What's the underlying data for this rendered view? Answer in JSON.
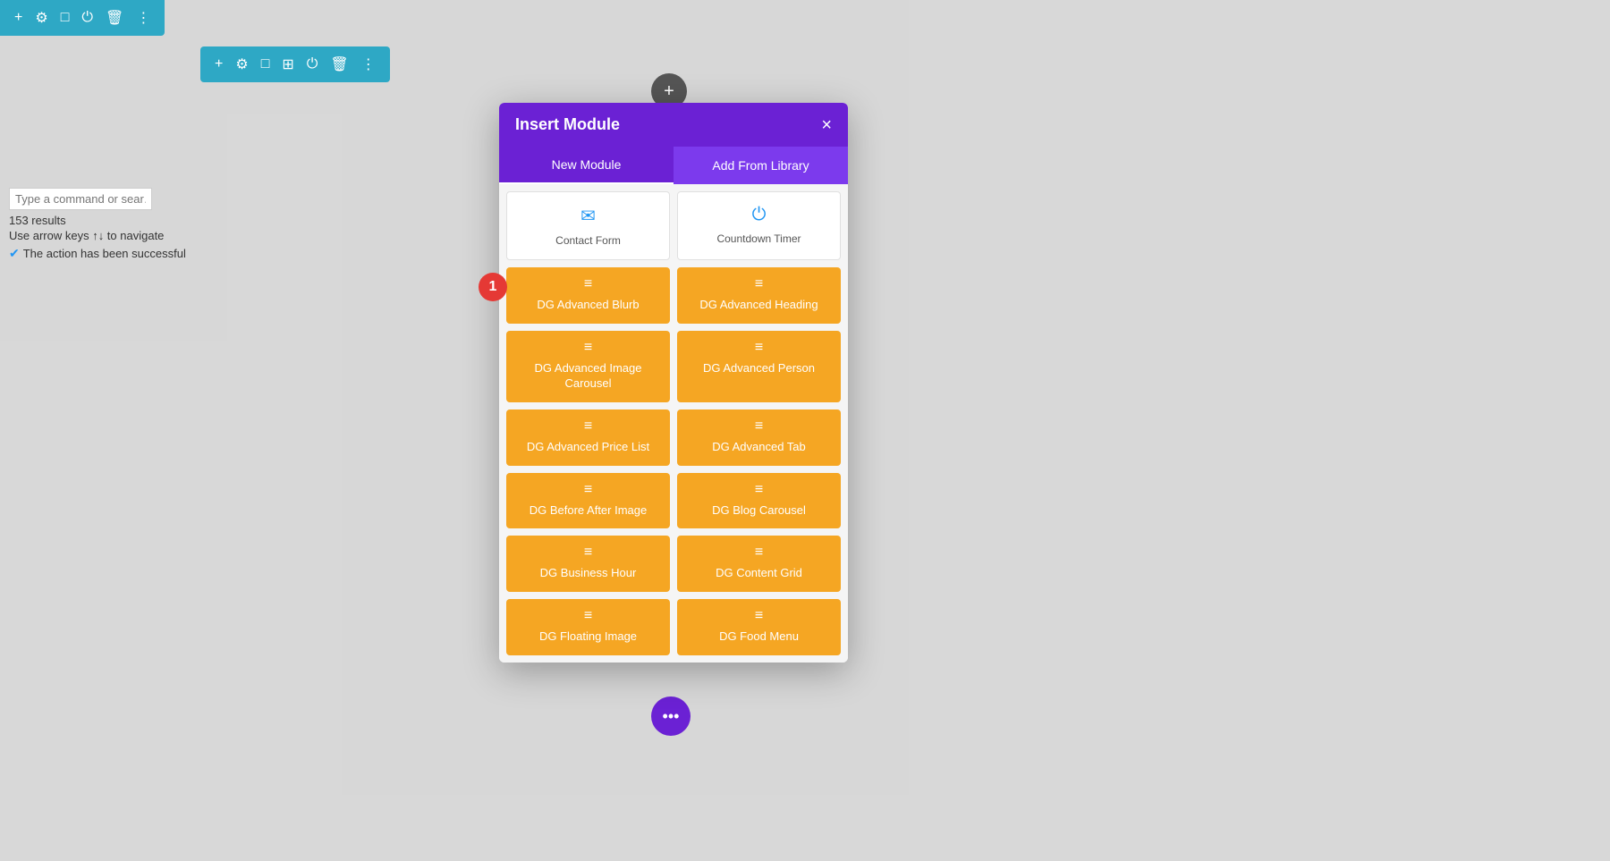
{
  "topToolbar": {
    "icons": [
      "+",
      "⚙",
      "□",
      "⏻",
      "🗑",
      "⋮"
    ]
  },
  "secondaryToolbar": {
    "icons": [
      "+",
      "⚙",
      "□",
      "⊞",
      "⏻",
      "🗑",
      "⋮"
    ]
  },
  "searchArea": {
    "placeholder": "Type a command or sear…",
    "results": "153 results",
    "nav": "Use arrow keys ↑↓ to navigate",
    "success": "The action has been successful"
  },
  "modal": {
    "title": "Insert Module",
    "closeLabel": "×",
    "tabs": [
      {
        "label": "New Module",
        "active": true
      },
      {
        "label": "Add From Library",
        "active": false
      }
    ],
    "whiteModules": [
      {
        "icon": "✉",
        "label": "Contact Form",
        "iconType": "email"
      },
      {
        "icon": "⏻",
        "label": "Countdown Timer",
        "iconType": "power"
      }
    ],
    "orangeModules": [
      {
        "label": "DG Advanced Blurb"
      },
      {
        "label": "DG Advanced Heading"
      },
      {
        "label": "DG Advanced Image Carousel"
      },
      {
        "label": "DG Advanced Person"
      },
      {
        "label": "DG Advanced Price List"
      },
      {
        "label": "DG Advanced Tab"
      },
      {
        "label": "DG Before After Image"
      },
      {
        "label": "DG Blog Carousel"
      },
      {
        "label": "DG Business Hour"
      },
      {
        "label": "DG Content Grid"
      },
      {
        "label": "DG Floating Image"
      },
      {
        "label": "DG Food Menu"
      }
    ]
  },
  "stepBadge": "1",
  "addButtonIcon": "+",
  "dotsButtonIcon": "•••"
}
